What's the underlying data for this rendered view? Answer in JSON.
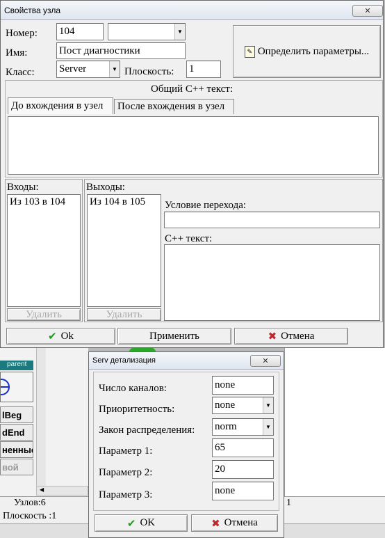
{
  "bg": {
    "parent_label": "parent",
    "buttons": [
      "lBeg",
      "dEnd",
      "ненные",
      "вой"
    ],
    "nodes_count": "Узлов:6",
    "plane": "Плоскость :1",
    "col_marker": "1"
  },
  "dialog1": {
    "title": "Свойства узла",
    "close": "✕",
    "number_label": "Номер:",
    "number_value": "104",
    "number_combo_value": "",
    "name_label": "Имя:",
    "name_value": "Пост диагностики",
    "class_label": "Класс:",
    "class_value": "Server",
    "plane_label": "Плоскость:",
    "plane_value": "1",
    "define_params": "Определить параметры...",
    "common_cpp": "Общий С++ текст:",
    "tabs": [
      "До вхождения в узел",
      "После вхождения в узел"
    ],
    "inputs_label": "Входы:",
    "inputs_items": [
      "Из 103 в 104"
    ],
    "outputs_label": "Выходы:",
    "outputs_items": [
      "Из 104 в 105"
    ],
    "delete_label": "Удалить",
    "condition_label": "Условие перехода:",
    "cpp_label": "С++ текст:",
    "ok": "Ok",
    "apply": "Применить",
    "cancel": "Отмена"
  },
  "dialog2": {
    "title": "Serv детализация",
    "close": "✕",
    "rows": [
      {
        "label": "Число каналов:",
        "value": "none",
        "combo": false
      },
      {
        "label": "Приоритетность:",
        "value": "none",
        "combo": true
      },
      {
        "label": "Закон распределения:",
        "value": "norm",
        "combo": true
      },
      {
        "label": "Параметр 1:",
        "value": "65",
        "combo": false
      },
      {
        "label": "Параметр 2:",
        "value": "20",
        "combo": false
      },
      {
        "label": "Параметр 3:",
        "value": "none",
        "combo": false
      }
    ],
    "ok": "OK",
    "cancel": "Отмена"
  },
  "colors": {
    "ok_green": "#1e9b1e",
    "cancel_red": "#c0282d",
    "teal": "#1a7a80",
    "node_blue": "#1530c8"
  }
}
